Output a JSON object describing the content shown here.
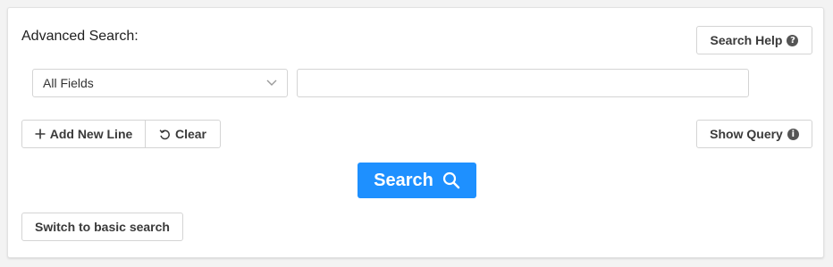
{
  "form": {
    "title": "Advanced Search:",
    "help_button": {
      "label": "Search Help",
      "icon": "question-circle-icon"
    },
    "field_select": {
      "selected": "All Fields"
    },
    "query_input": {
      "value": "",
      "placeholder": ""
    },
    "add_line_button": {
      "label": "Add New Line",
      "icon": "plus-icon"
    },
    "clear_button": {
      "label": "Clear",
      "icon": "undo-icon"
    },
    "show_query_button": {
      "label": "Show Query",
      "icon": "info-circle-icon"
    },
    "search_button": {
      "label": "Search",
      "icon": "search-icon"
    },
    "switch_button": {
      "label": "Switch to basic search"
    }
  },
  "colors": {
    "accent": "#1e90ff",
    "border": "#d4d4d4",
    "background": "#f3f3f3"
  }
}
